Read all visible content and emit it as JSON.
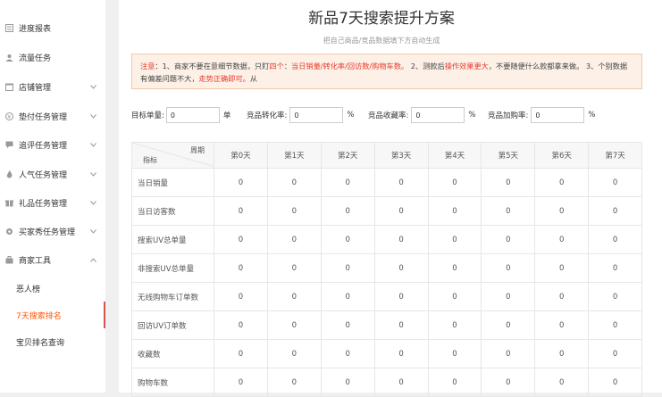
{
  "sidebar": {
    "items": [
      {
        "label": "进度报表",
        "icon": "report-icon"
      },
      {
        "label": "流量任务",
        "icon": "user-icon"
      },
      {
        "label": "店铺管理",
        "icon": "shop-icon"
      },
      {
        "label": "垫付任务管理",
        "icon": "money-icon"
      },
      {
        "label": "追评任务管理",
        "icon": "comment-icon"
      },
      {
        "label": "人气任务管理",
        "icon": "fire-icon"
      },
      {
        "label": "礼品任务管理",
        "icon": "gift-icon"
      },
      {
        "label": "买家秀任务管理",
        "icon": "gear-icon"
      },
      {
        "label": "商家工具",
        "icon": "tool-icon"
      }
    ],
    "subitems": [
      {
        "label": "恶人榜"
      },
      {
        "label": "7天搜索排名"
      },
      {
        "label": "宝贝排名查询"
      }
    ]
  },
  "main": {
    "title": "新品7天搜索提升方案",
    "subtitle": "把自己商品/竞品数据填下方自动生成",
    "notice": {
      "p1": "注意",
      "p2": "：1、商家不要在意细节数据，只盯",
      "p3": "四个",
      "p4": "：",
      "p5": "当日销量/转化率/回访数/购物车数。",
      "p6": "2、测款后",
      "p7": "操作效果更大",
      "p8": "，不要随便什么款都拿来做。 3、个别数据有偏差问题不大，",
      "p9": "走势正确即可。",
      "p10": "从"
    },
    "form": {
      "target_label": "目标单量:",
      "target_value": "0",
      "target_unit": "单",
      "conv_label": "竞品转化率:",
      "conv_value": "0",
      "conv_unit": "%",
      "fav_label": "竞品收藏率:",
      "fav_value": "0",
      "fav_unit": "%",
      "cart_label": "竞品加购率:",
      "cart_value": "0",
      "cart_unit": "%"
    },
    "table": {
      "corner_top": "周期",
      "corner_bottom": "指标",
      "days": [
        "第0天",
        "第1天",
        "第2天",
        "第3天",
        "第4天",
        "第5天",
        "第6天",
        "第7天"
      ],
      "rows": [
        {
          "label": "当日销量",
          "values": [
            "0",
            "0",
            "0",
            "0",
            "0",
            "0",
            "0",
            "0"
          ]
        },
        {
          "label": "当日访客数",
          "values": [
            "0",
            "0",
            "0",
            "0",
            "0",
            "0",
            "0",
            "0"
          ]
        },
        {
          "label": "搜索UV总单量",
          "values": [
            "0",
            "0",
            "0",
            "0",
            "0",
            "0",
            "0",
            "0"
          ]
        },
        {
          "label": "非搜索UV总单量",
          "values": [
            "0",
            "0",
            "0",
            "0",
            "0",
            "0",
            "0",
            "0"
          ]
        },
        {
          "label": "无线购物车订单数",
          "values": [
            "0",
            "0",
            "0",
            "0",
            "0",
            "0",
            "0",
            "0"
          ]
        },
        {
          "label": "回访UV订单数",
          "values": [
            "0",
            "0",
            "0",
            "0",
            "0",
            "0",
            "0",
            "0"
          ]
        },
        {
          "label": "收藏数",
          "values": [
            "0",
            "0",
            "0",
            "0",
            "0",
            "0",
            "0",
            "0"
          ]
        },
        {
          "label": "购物车数",
          "values": [
            "0",
            "0",
            "0",
            "0",
            "0",
            "0",
            "0",
            "0"
          ]
        }
      ]
    }
  }
}
